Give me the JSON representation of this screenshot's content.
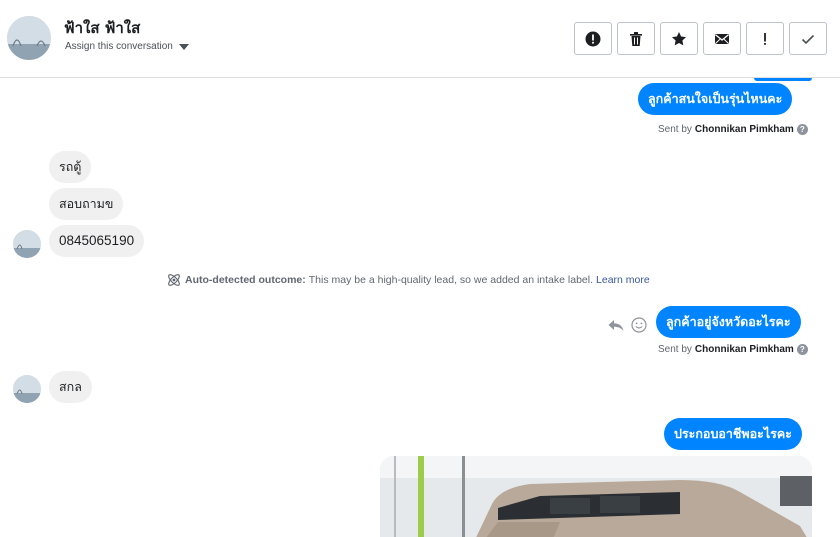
{
  "header": {
    "contact_name": "ฟ้าใส ฟ้าใส",
    "assign_label": "Assign this conversation",
    "toolbar": [
      {
        "name": "spam-button",
        "icon": "alert-circle-icon"
      },
      {
        "name": "delete-button",
        "icon": "trash-icon"
      },
      {
        "name": "star-button",
        "icon": "star-icon"
      },
      {
        "name": "mark-unread-button",
        "icon": "envelope-icon"
      },
      {
        "name": "follow-up-button",
        "icon": "exclamation-icon"
      },
      {
        "name": "mark-done-button",
        "icon": "check-icon"
      }
    ]
  },
  "messages": {
    "out1": "ลูกค้าสนใจเป็นรุ่นไหนคะ",
    "sent1": {
      "prefix": "Sent by",
      "name": "Chonnikan Pimkham"
    },
    "in1": "รถตู้",
    "in2": "สอบถามข",
    "in3": "0845065190",
    "outcome": {
      "title": "Auto-detected outcome:",
      "text": "This may be a high-quality lead, so we added an intake label.",
      "link": "Learn more"
    },
    "out2": "ลูกค้าอยู่จังหวัดอะไรคะ",
    "sent2": {
      "prefix": "Sent by",
      "name": "Chonnikan Pimkham"
    },
    "in4": "สกล",
    "out3": "ประกอบอาชีพอะไรคะ"
  },
  "colors": {
    "accent": "#0084ff",
    "incoming_bubble": "#f1f0f0",
    "border": "#dddfe2"
  }
}
